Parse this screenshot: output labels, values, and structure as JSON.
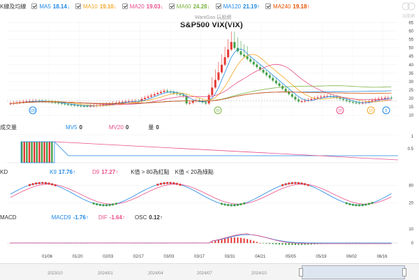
{
  "price_legend": {
    "label": "K線及均線",
    "items": [
      {
        "name": "MA5",
        "value": "18.14↓",
        "color": "#1e88e5"
      },
      {
        "name": "MA10",
        "value": "19.10↓",
        "color": "#f5a623"
      },
      {
        "name": "MA20",
        "value": "19.03↓",
        "color": "#e94e8a"
      },
      {
        "name": "MA60",
        "value": "24.28↓",
        "color": "#7cb342"
      },
      {
        "name": "MA120",
        "value": "21.19↑",
        "color": "#1e88e5"
      },
      {
        "name": "MA240",
        "value": "19.18↑",
        "color": "#e65100"
      }
    ]
  },
  "chart_subtitle": "WantGoo 玩股網",
  "chart_title": "S&P500 VIX(VIX)",
  "volume_legend": {
    "label": "成交量",
    "mv5_name": "MV5",
    "mv5_value": "0",
    "mv20_name": "MV20",
    "mv20_value": "0",
    "vol_name": "量",
    "vol_value": "0"
  },
  "kd_legend": {
    "label": "KD",
    "k_name": "K9",
    "k_value": "17.76↑",
    "d_name": "D9",
    "d_value": "17.27↑",
    "note1": "K值 > 80為紅點",
    "note2": "K值 < 20為綠點"
  },
  "macd_legend": {
    "label": "MACD",
    "macd_name": "MACD9",
    "macd_value": "-1.76↑",
    "dif_name": "DIF",
    "dif_value": "-1.64↑",
    "osc_name": "OSC",
    "osc_value": "0.12↑"
  },
  "price_yticks": [
    "65",
    "60",
    "55",
    "50",
    "45",
    "40",
    "35",
    "30",
    "25",
    "20",
    "15",
    "10"
  ],
  "volume_yticks": [
    "1",
    "0.5"
  ],
  "kd_yticks": [
    "80",
    "20"
  ],
  "macd_yticks": [
    "10",
    "0"
  ],
  "x_labels": [
    "01/06",
    "01/20",
    "02/03",
    "02/17",
    "03/03",
    "03/17",
    "03/31",
    "04/21",
    "05/05",
    "05/19",
    "06/02",
    "06/16"
  ],
  "year_labels": [
    "2023/10",
    "2024/01",
    "2024/04",
    "2024/07",
    "2024/10",
    "2025/01",
    "2025/04"
  ],
  "markers": [
    {
      "text": "120",
      "color": "#1e88e5"
    },
    {
      "text": "60",
      "color": "#7cb342"
    },
    {
      "text": "20",
      "color": "#e94e8a"
    },
    {
      "text": "10",
      "color": "#f5a623"
    },
    {
      "text": "5",
      "color": "#1e88e5"
    }
  ],
  "colors": {
    "up": "#e53935",
    "down": "#43a047",
    "k": "#1e88e5",
    "d": "#e94e8a"
  },
  "watermark": "玩股網"
}
